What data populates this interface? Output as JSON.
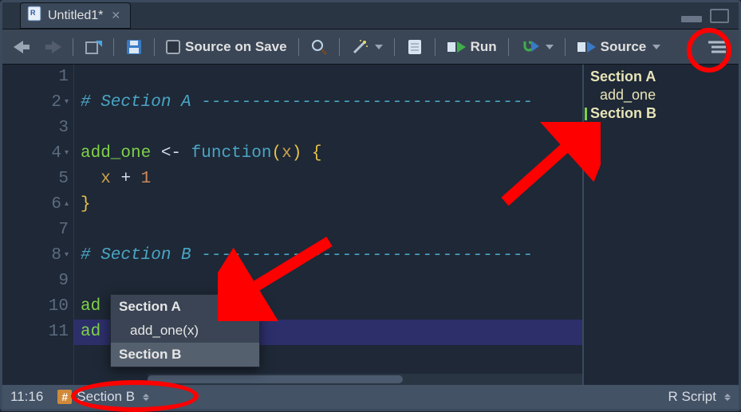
{
  "tab": {
    "title": "Untitled1*"
  },
  "toolbar": {
    "source_on_save": "Source on Save",
    "run": "Run",
    "source": "Source"
  },
  "code": {
    "lines": [
      {
        "n": 1,
        "fold": "",
        "content": ""
      },
      {
        "n": 2,
        "fold": "▾",
        "content": "# Section A ---------------------------------"
      },
      {
        "n": 3,
        "fold": "",
        "content": ""
      },
      {
        "n": 4,
        "fold": "▾",
        "content": "add_one <- function(x) {"
      },
      {
        "n": 5,
        "fold": "",
        "content": "  x + 1"
      },
      {
        "n": 6,
        "fold": "▴",
        "content": "}"
      },
      {
        "n": 7,
        "fold": "",
        "content": ""
      },
      {
        "n": 8,
        "fold": "▾",
        "content": "# Section B ---------------------------------"
      },
      {
        "n": 9,
        "fold": "",
        "content": ""
      },
      {
        "n": 10,
        "fold": "",
        "content": "ad"
      },
      {
        "n": 11,
        "fold": "",
        "content": "ad"
      }
    ]
  },
  "outline": {
    "items": [
      {
        "label": "Section A",
        "indent": false,
        "active": false
      },
      {
        "label": "add_one",
        "indent": true,
        "active": false
      },
      {
        "label": "Section B",
        "indent": false,
        "active": true
      }
    ]
  },
  "popup": {
    "items": [
      {
        "label": "Section A",
        "bold": true,
        "indent": false,
        "sel": false
      },
      {
        "label": "add_one(x)",
        "bold": false,
        "indent": true,
        "sel": false
      },
      {
        "label": "Section B",
        "bold": true,
        "indent": false,
        "sel": true
      }
    ]
  },
  "status": {
    "pos": "11:16",
    "crumb": "Section B",
    "lang": "R Script"
  }
}
